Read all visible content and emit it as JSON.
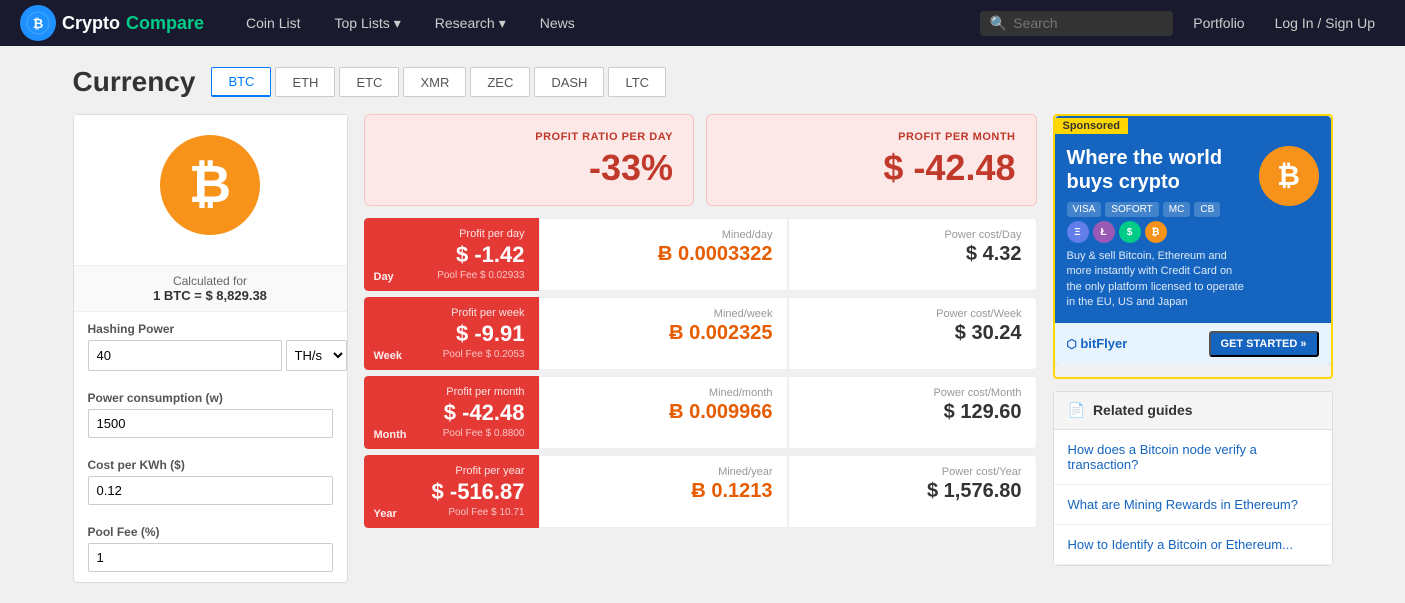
{
  "brand": {
    "name_crypto": "Crypto",
    "name_compare": "Compare",
    "logo_text": "₿"
  },
  "nav": {
    "coin_list": "Coin List",
    "top_lists": "Top Lists",
    "research": "Research",
    "news": "News",
    "search_placeholder": "Search",
    "portfolio": "Portfolio",
    "login": "Log In / Sign Up"
  },
  "currency": {
    "title": "Currency",
    "tabs": [
      "BTC",
      "ETH",
      "ETC",
      "XMR",
      "ZEC",
      "DASH",
      "LTC"
    ],
    "active_tab": "BTC"
  },
  "left_panel": {
    "btc_symbol": "₿",
    "calc_for_label": "Calculated for",
    "calc_value": "1 BTC = $ 8,829.38",
    "hashing_power_label": "Hashing Power",
    "hashing_power_value": "40",
    "hashing_unit": "TH/s",
    "power_consumption_label": "Power consumption (w)",
    "power_consumption_value": "1500",
    "cost_per_kwh_label": "Cost per KWh ($)",
    "cost_per_kwh_value": "0.12",
    "pool_fee_label": "Pool Fee (%)",
    "pool_fee_value": "1"
  },
  "profit_summary": {
    "ratio_label": "PROFIT RATIO PER DAY",
    "ratio_value": "-33%",
    "month_label": "PROFIT PER MONTH",
    "month_value": "$ -42.48"
  },
  "profit_rows": [
    {
      "period": "Day",
      "profit_label": "Profit per day",
      "profit_value": "$ -1.42",
      "pool_fee": "Pool Fee $ 0.02933",
      "mined_label": "Mined/day",
      "mined_value": "Ƀ 0.0003322",
      "power_label": "Power cost/Day",
      "power_value": "$ 4.32"
    },
    {
      "period": "Week",
      "profit_label": "Profit per week",
      "profit_value": "$ -9.91",
      "pool_fee": "Pool Fee $ 0.2053",
      "mined_label": "Mined/week",
      "mined_value": "Ƀ 0.002325",
      "power_label": "Power cost/Week",
      "power_value": "$ 30.24"
    },
    {
      "period": "Month",
      "profit_label": "Profit per month",
      "profit_value": "$ -42.48",
      "pool_fee": "Pool Fee $ 0.8800",
      "mined_label": "Mined/month",
      "mined_value": "Ƀ 0.009966",
      "power_label": "Power cost/Month",
      "power_value": "$ 129.60"
    },
    {
      "period": "Year",
      "profit_label": "Profit per year",
      "profit_value": "$ -516.87",
      "pool_fee": "Pool Fee $ 10.71",
      "mined_label": "Mined/year",
      "mined_value": "Ƀ 0.1213",
      "power_label": "Power cost/Year",
      "power_value": "$ 1,576.80"
    }
  ],
  "banner": {
    "sponsored": "Sponsored",
    "headline": "Where the world buys crypto",
    "description": "Buy & sell Bitcoin, Ethereum and more instantly with Credit Card on the only platform licensed to operate in the EU, US and Japan",
    "payment_icons": [
      "VISA",
      "SOFORT",
      "",
      ""
    ],
    "cta": "GET STARTED »",
    "logo": "bitFlyer"
  },
  "related_guides": {
    "title": "Related guides",
    "links": [
      "How does a Bitcoin node verify a transaction?",
      "What are Mining Rewards in Ethereum?",
      "How to Identify a Bitcoin or Ethereum..."
    ]
  }
}
